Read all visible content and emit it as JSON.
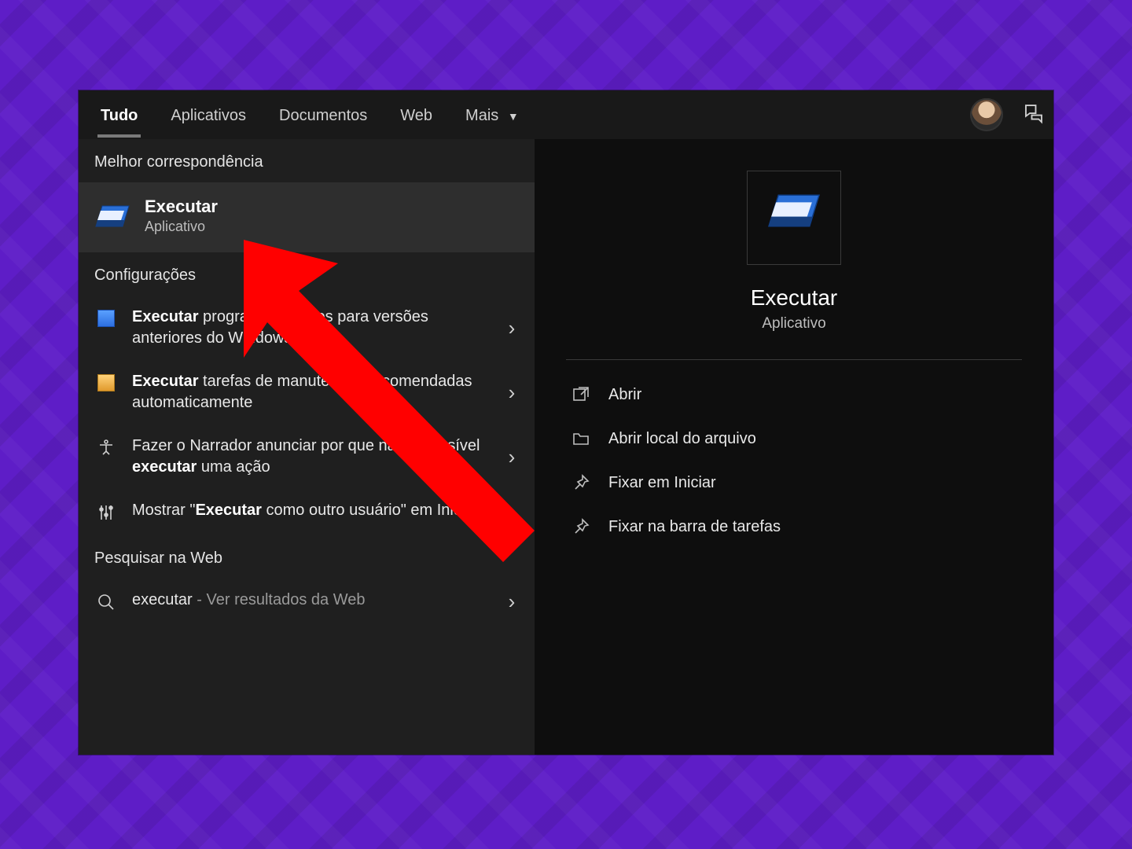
{
  "tabs": {
    "all": "Tudo",
    "apps": "Aplicativos",
    "docs": "Documentos",
    "web": "Web",
    "more": "Mais"
  },
  "left": {
    "best_label": "Melhor correspondência",
    "best_title": "Executar",
    "best_sub": "Aplicativo",
    "settings_label": "Configurações",
    "s1_a": "Executar",
    "s1_b": " programas criados para versões anteriores do Windows",
    "s2_a": "Executar",
    "s2_b": " tarefas de manutenção recomendadas automaticamente",
    "s3_a": "Fazer o Narrador anunciar por que não é possível ",
    "s3_b": "executar",
    "s3_c": " uma ação",
    "s4_a": "Mostrar \"",
    "s4_b": "Executar",
    "s4_c": " como outro usuário\" em Iniciar",
    "web_label": "Pesquisar na Web",
    "w1_a": "executar",
    "w1_b": " - Ver resultados da Web"
  },
  "right": {
    "title": "Executar",
    "sub": "Aplicativo",
    "a1": "Abrir",
    "a2": "Abrir local do arquivo",
    "a3": "Fixar em Iniciar",
    "a4": "Fixar na barra de tarefas"
  }
}
